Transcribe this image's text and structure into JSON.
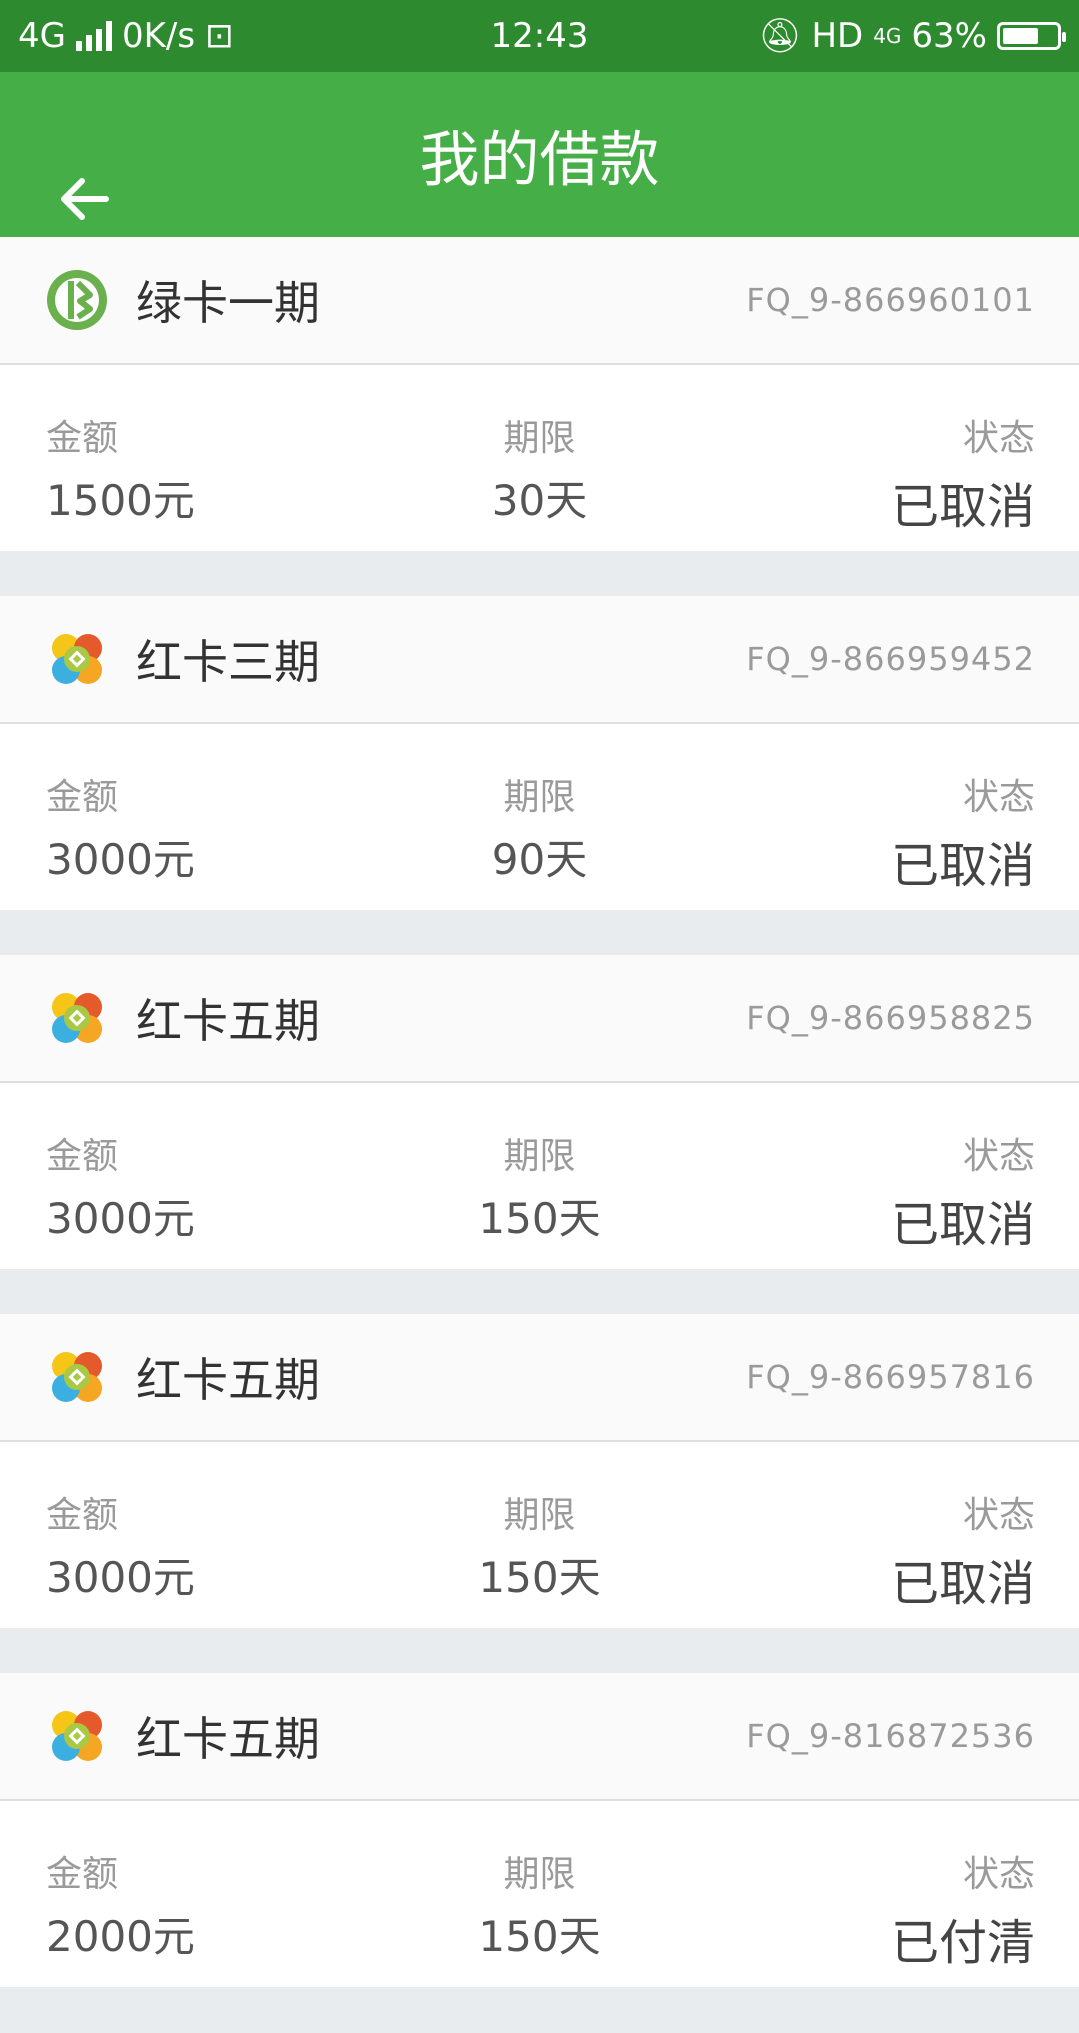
{
  "status_bar": {
    "network": "4G",
    "speed": "0K/s",
    "time": "12:43",
    "hd": "HD",
    "net2": "4G",
    "battery": "63%"
  },
  "app_bar": {
    "title": "我的借款"
  },
  "labels": {
    "amount": "金额",
    "term": "期限",
    "status": "状态"
  },
  "loans": [
    {
      "name": "绿卡一期",
      "code": "FQ_9-866960101",
      "amount": "1500元",
      "term": "30天",
      "status": "已取消",
      "logo": "green-card-icon"
    },
    {
      "name": "红卡三期",
      "code": "FQ_9-866959452",
      "amount": "3000元",
      "term": "90天",
      "status": "已取消",
      "logo": "red-card-icon"
    },
    {
      "name": "红卡五期",
      "code": "FQ_9-866958825",
      "amount": "3000元",
      "term": "150天",
      "status": "已取消",
      "logo": "red-card-icon"
    },
    {
      "name": "红卡五期",
      "code": "FQ_9-866957816",
      "amount": "3000元",
      "term": "150天",
      "status": "已取消",
      "logo": "red-card-icon"
    },
    {
      "name": "红卡五期",
      "code": "FQ_9-816872536",
      "amount": "2000元",
      "term": "150天",
      "status": "已付清",
      "logo": "red-card-icon"
    }
  ],
  "colors": {
    "status_bar": "#2e8a2f",
    "app_bar": "#46ae47",
    "background": "#e9ecee"
  }
}
